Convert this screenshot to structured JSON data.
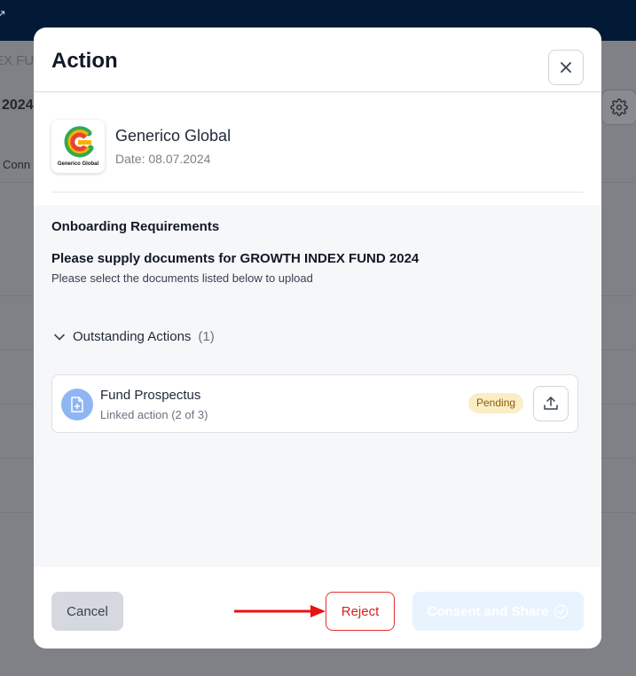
{
  "background": {
    "breadcrumb_fragment": "EX FUN",
    "year_fragment": "2024",
    "column_fragment": "Conn"
  },
  "modal": {
    "title": "Action",
    "close_icon": "close-icon",
    "company": {
      "name": "Generico Global",
      "date": "Date: 08.07.2024",
      "logo_text": "Generico Global"
    },
    "requirements": {
      "heading": "Onboarding Requirements",
      "supply_title": "Please supply documents for GROWTH INDEX FUND 2024",
      "supply_subtitle": "Please select the documents listed below to upload"
    },
    "outstanding": {
      "label": "Outstanding Actions",
      "count": "(1)",
      "icon": "chevron-down-icon"
    },
    "items": [
      {
        "title": "Fund Prospectus",
        "subtitle": "Linked action (2 of 3)",
        "status": "Pending",
        "icon": "document-add-icon",
        "action_icon": "upload-icon"
      }
    ],
    "footer": {
      "cancel_label": "Cancel",
      "reject_label": "Reject",
      "consent_label": "Consent and Share",
      "consent_icon": "check-circle-icon"
    }
  },
  "colors": {
    "topbar": "#031a36",
    "reject": "#e33131",
    "pending_bg": "#fbeec7",
    "consent_bg": "#e8f3fd",
    "doc_icon_bg": "#8fb6f3"
  }
}
